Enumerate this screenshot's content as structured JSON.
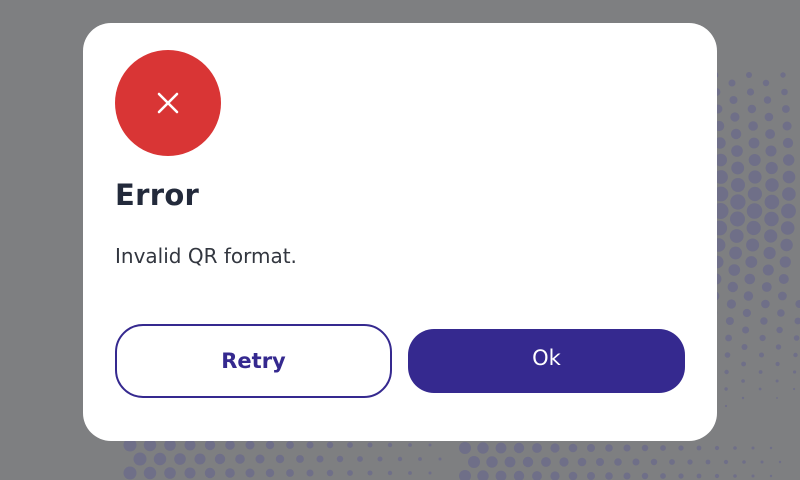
{
  "background": {
    "color": "#7e7f81",
    "dot_color": "#6c6c8a"
  },
  "dialog": {
    "status_icon": "close-x-icon",
    "status_color": "#d93535",
    "title": "Error",
    "message": "Invalid QR format.",
    "buttons": {
      "retry_label": "Retry",
      "ok_label": "Ok"
    },
    "accent_color": "#35298f"
  }
}
